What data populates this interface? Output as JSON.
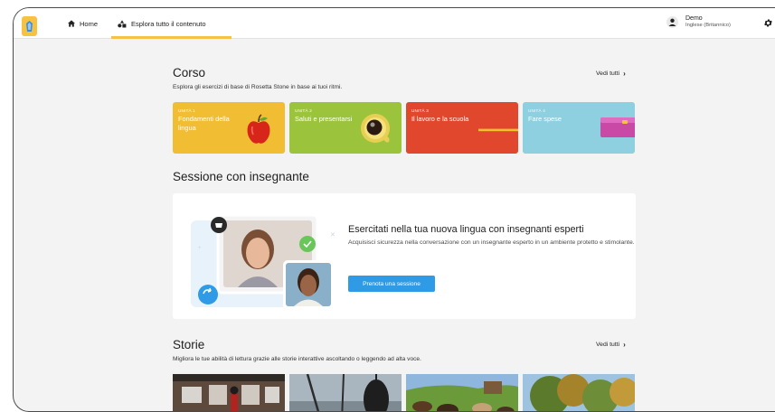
{
  "nav": {
    "home_label": "Home",
    "explore_label": "Esplora tutto il contenuto"
  },
  "user": {
    "name": "Demo",
    "language": "Inglese (Britannico)"
  },
  "course": {
    "title": "Corso",
    "subtitle": "Esplora gli esercizi di base di Rosetta Stone in base ai tuoi ritmi.",
    "see_all": "Vedi tutti",
    "units": [
      {
        "number": "UNITÀ 1",
        "title": "Fondamenti della lingua",
        "color": "#f1be33"
      },
      {
        "number": "UNITÀ 2",
        "title": "Saluti e presentarsi",
        "color": "#9bc43c"
      },
      {
        "number": "UNITÀ 3",
        "title": "Il lavoro e la scuola",
        "color": "#e1472d"
      },
      {
        "number": "UNITÀ 4",
        "title": "Fare spese",
        "color": "#8ecfe0"
      }
    ]
  },
  "tutor": {
    "section_title": "Sessione con insegnante",
    "heading": "Esercitati nella tua nuova lingua con insegnanti esperti",
    "description": "Acquisisci sicurezza nella conversazione con un insegnante esperto in un ambiente protetto e stimolante.",
    "button_label": "Prenota una sessione"
  },
  "stories": {
    "title": "Storie",
    "subtitle": "Migliora le tue abilità di lettura grazie alle storie interattive ascoltando o leggendo ad alta voce.",
    "see_all": "Vedi tutti"
  },
  "colors": {
    "accent": "#f6c244",
    "button": "#2f9be6"
  }
}
